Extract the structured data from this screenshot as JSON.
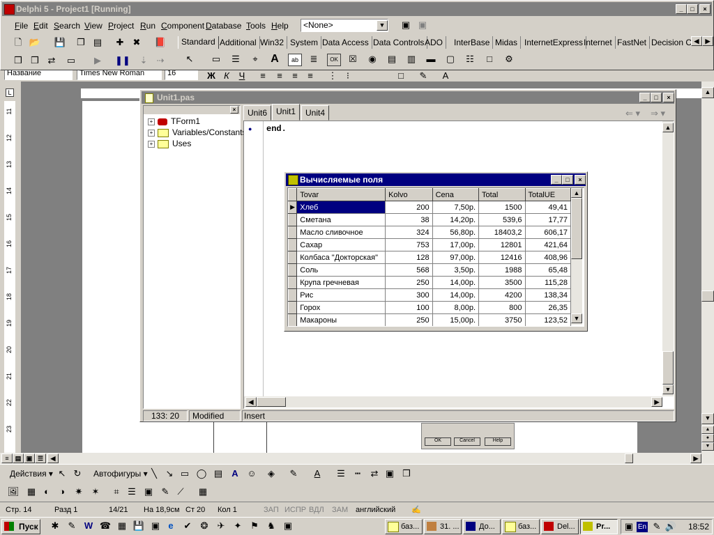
{
  "delphi": {
    "title": "Delphi 5 - Project1 [Running]",
    "menu": [
      "File",
      "Edit",
      "Search",
      "View",
      "Project",
      "Run",
      "Component",
      "Database",
      "Tools",
      "Help"
    ],
    "combo_value": "<None>",
    "palette_tabs": [
      "Standard",
      "Additional",
      "Win32",
      "System",
      "Data Access",
      "Data Controls",
      "ADO",
      "InterBase",
      "Midas",
      "InternetExpress",
      "Internet",
      "FastNet",
      "Decision C"
    ]
  },
  "word": {
    "style_value": "Название",
    "font_value": "Times New Roman",
    "size_value": "16",
    "ruler_numbers": [
      "11",
      "12",
      "13",
      "14",
      "15",
      "16",
      "17",
      "18",
      "19",
      "20",
      "21",
      "22",
      "23"
    ],
    "draw_actions": "Действия",
    "autoshapes": "Автофигуры",
    "status": {
      "page": "Стр. 14",
      "section": "Разд 1",
      "pages": "14/21",
      "at": "На 18,9см",
      "line": "Ст 20",
      "col": "Кол 1",
      "rec": "ЗАП",
      "trk": "ИСПР",
      "ext": "ВДЛ",
      "ovr": "ЗАМ",
      "lang": "английский"
    },
    "dialog_buttons": [
      "OK",
      "Cancel",
      "Help"
    ]
  },
  "editor": {
    "title": "Unit1.pas",
    "tabs": [
      "Unit6",
      "Unit1",
      "Unit4"
    ],
    "tree": [
      "TForm1",
      "Variables/Constants",
      "Uses"
    ],
    "code": "end.",
    "status_pos": "133: 20",
    "status_modified": "Modified",
    "status_mode": "Insert"
  },
  "dbform": {
    "title": "Вычисляемые поля",
    "columns": [
      "Tovar",
      "Kolvo",
      "Cena",
      "Total",
      "TotalUE"
    ],
    "rows": [
      [
        "Хлеб",
        "200",
        "7,50р.",
        "1500",
        "49,41"
      ],
      [
        "Сметана",
        "38",
        "14,20р.",
        "539,6",
        "17,77"
      ],
      [
        "Масло сливочное",
        "324",
        "56,80р.",
        "18403,2",
        "606,17"
      ],
      [
        "Сахар",
        "753",
        "17,00р.",
        "12801",
        "421,64"
      ],
      [
        "Колбаса \"Докторская\"",
        "128",
        "97,00р.",
        "12416",
        "408,96"
      ],
      [
        "Соль",
        "568",
        "3,50р.",
        "1988",
        "65,48"
      ],
      [
        "Крупа гречневая",
        "250",
        "14,00р.",
        "3500",
        "115,28"
      ],
      [
        "Рис",
        "300",
        "14,00р.",
        "4200",
        "138,34"
      ],
      [
        "Горох",
        "100",
        "8,00р.",
        "800",
        "26,35"
      ],
      [
        "Макароны",
        "250",
        "15,00р.",
        "3750",
        "123,52"
      ]
    ]
  },
  "taskbar": {
    "start": "Пуск",
    "tasks": [
      "баз...",
      "31. ...",
      "До...",
      "баз...",
      "Del...",
      "Pr..."
    ],
    "clock": "18:52",
    "lang": "En"
  }
}
